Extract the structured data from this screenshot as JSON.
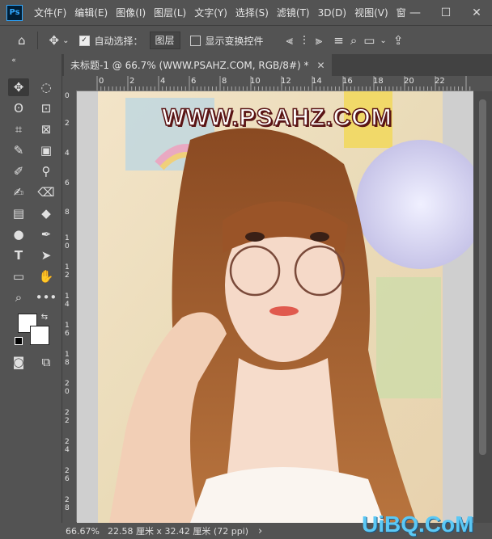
{
  "app": {
    "logo_text": "Ps"
  },
  "menu": [
    {
      "id": "file",
      "label": "文件(F)"
    },
    {
      "id": "edit",
      "label": "编辑(E)"
    },
    {
      "id": "image",
      "label": "图像(I)"
    },
    {
      "id": "layer",
      "label": "图层(L)"
    },
    {
      "id": "type",
      "label": "文字(Y)"
    },
    {
      "id": "select",
      "label": "选择(S)"
    },
    {
      "id": "filter",
      "label": "滤镜(T)"
    },
    {
      "id": "3d",
      "label": "3D(D)"
    },
    {
      "id": "view",
      "label": "视图(V)"
    },
    {
      "id": "window",
      "label": "窗"
    }
  ],
  "window_controls": {
    "minimize": "—",
    "maximize": "☐",
    "close": "✕"
  },
  "options": {
    "auto_select_label": "自动选择：",
    "auto_select_checked": true,
    "auto_select_target": "图层",
    "show_transform_label": "显示变换控件",
    "show_transform_checked": false
  },
  "document": {
    "tab_title": "未标题-1 @ 66.7% (WWW.PSAHZ.COM, RGB/8#) *",
    "watermark": "WWW.PSAHZ.COM"
  },
  "rulers": {
    "h_ticks": [
      "0",
      "2",
      "4",
      "6",
      "8",
      "10",
      "12",
      "14",
      "16",
      "18",
      "20",
      "22"
    ],
    "v_ticks": [
      "0",
      "2",
      "4",
      "6",
      "8",
      "1\n0",
      "1\n2",
      "1\n4",
      "1\n6",
      "1\n8",
      "2\n0",
      "2\n2",
      "2\n4",
      "2\n6",
      "2\n8"
    ]
  },
  "status": {
    "zoom": "66.67%",
    "doc_size": "22.58 厘米 x 32.42 厘米 (72 ppi)",
    "arrow": "›"
  },
  "corner_watermark": "UiBQ.CoM",
  "colors": {
    "foreground": "#ffffff",
    "background": "#ffffff"
  }
}
